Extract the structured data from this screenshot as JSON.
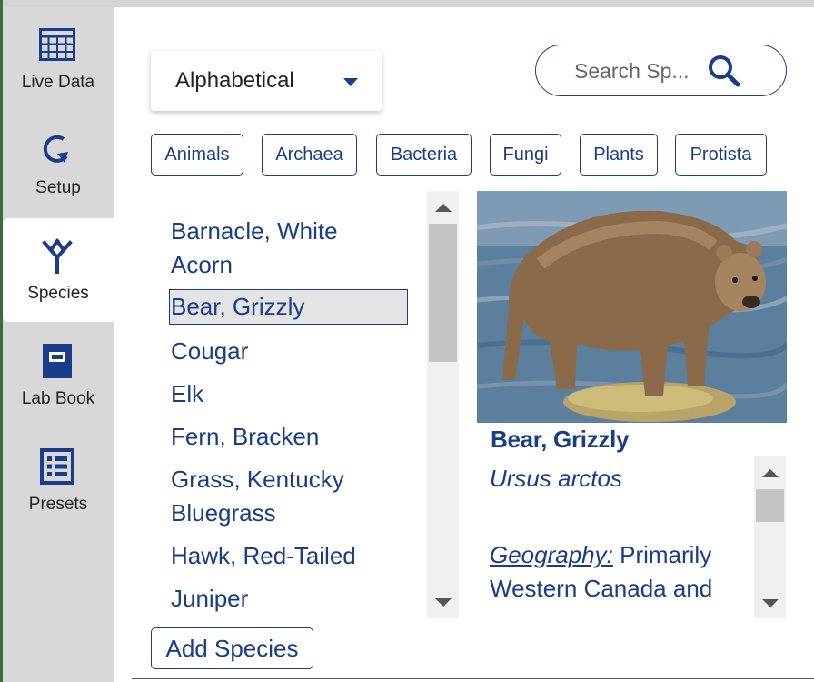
{
  "nav": [
    {
      "label": "Live Data",
      "icon": "grid-table-icon"
    },
    {
      "label": "Setup",
      "icon": "refresh-arrow-icon"
    },
    {
      "label": "Species",
      "icon": "species-tree-icon",
      "active": true
    },
    {
      "label": "Lab Book",
      "icon": "notebook-icon"
    },
    {
      "label": "Presets",
      "icon": "list-grid-icon"
    }
  ],
  "sort": {
    "label": "Alphabetical"
  },
  "search": {
    "placeholder": "Search Sp..."
  },
  "filters": [
    "Animals",
    "Archaea",
    "Bacteria",
    "Fungi",
    "Plants",
    "Protista"
  ],
  "species_list": [
    {
      "line1": "Barnacle, White",
      "line2": "Acorn"
    },
    {
      "line1": "Bear, Grizzly",
      "selected": true
    },
    {
      "line1": "Cougar"
    },
    {
      "line1": "Elk"
    },
    {
      "line1": "Fern, Bracken"
    },
    {
      "line1": "Grass, Kentucky",
      "line2": "Bluegrass"
    },
    {
      "line1": "Hawk, Red-Tailed"
    },
    {
      "line1": "Juniper"
    }
  ],
  "detail": {
    "name": "Bear, Grizzly",
    "scientific": "Ursus arctos",
    "geography_label": "Geography:",
    "geography_text": " Primarily Western Canada and"
  },
  "add_button": "Add Species",
  "colors": {
    "accent": "#1a3c8a",
    "sidebar": "#d8d8d8",
    "selected_bg": "#e4e4e4"
  }
}
